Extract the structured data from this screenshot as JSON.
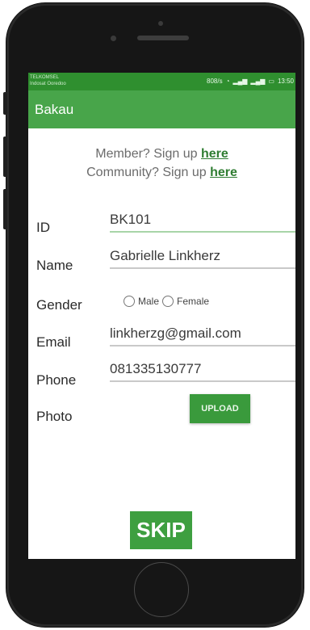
{
  "status_bar": {
    "carrier_line1": "TELKOMSEL",
    "carrier_line2": "Indosat Ooredoo",
    "speed": "808/s",
    "time": "13:50"
  },
  "appbar": {
    "title": "Bakau"
  },
  "signup": {
    "member_prefix": "Member? Sign up ",
    "member_link": "here",
    "community_prefix": "Community? Sign up ",
    "community_link": "here"
  },
  "form": {
    "id_label": "ID",
    "id_value": "BK101",
    "name_label": "Name",
    "name_value": "Gabrielle Linkherz",
    "gender_label": "Gender",
    "gender_male": "Male",
    "gender_female": "Female",
    "email_label": "Email",
    "email_value": "linkherzg@gmail.com",
    "phone_label": "Phone",
    "phone_value": "081335130777",
    "photo_label": "Photo",
    "upload_label": "UPLOAD"
  },
  "skip_label": "SKIP",
  "colors": {
    "status_bar": "#2f8f2f",
    "app_bar": "#48a54a",
    "button": "#3e9f40",
    "link": "#2f7d32"
  }
}
